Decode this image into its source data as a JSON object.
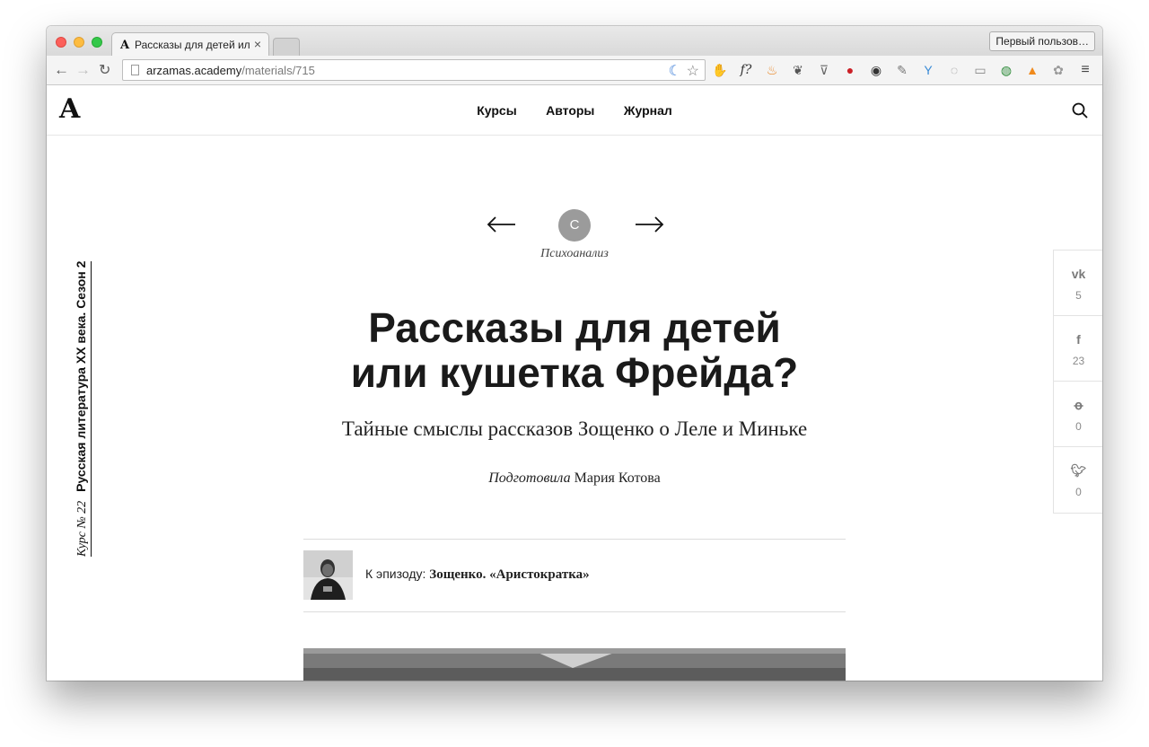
{
  "browser": {
    "tab_title": "Рассказы для детей или кушетка Фрейда?",
    "profile_button": "Первый пользов…",
    "url_host": "arzamas.academy",
    "url_path": "/materials/715"
  },
  "site": {
    "logo": "A",
    "nav": [
      "Курсы",
      "Авторы",
      "Журнал"
    ],
    "course_number": "Курс № 22",
    "course_title": "Русская литература XX века. Сезон 2",
    "category_letter": "С",
    "category": "Психоанализ",
    "title_line1": "Рассказы для детей",
    "title_line2": "или кушетка Фрейда?",
    "subtitle": "Тайные смыслы рассказов Зощенко о Леле и Миньке",
    "byline_role": "Подготовила",
    "byline_author": "Мария Котова",
    "episode_prefix": "К эпизоду:",
    "episode_title": "Зощенко. «Аристократка»"
  },
  "share": [
    {
      "icon": "vk-icon",
      "glyph": "vk",
      "count": "5"
    },
    {
      "icon": "facebook-icon",
      "glyph": "f",
      "count": "23"
    },
    {
      "icon": "odnoklassniki-icon",
      "glyph": "ok",
      "count": "0"
    },
    {
      "icon": "twitter-icon",
      "glyph": "tw",
      "count": "0"
    }
  ]
}
